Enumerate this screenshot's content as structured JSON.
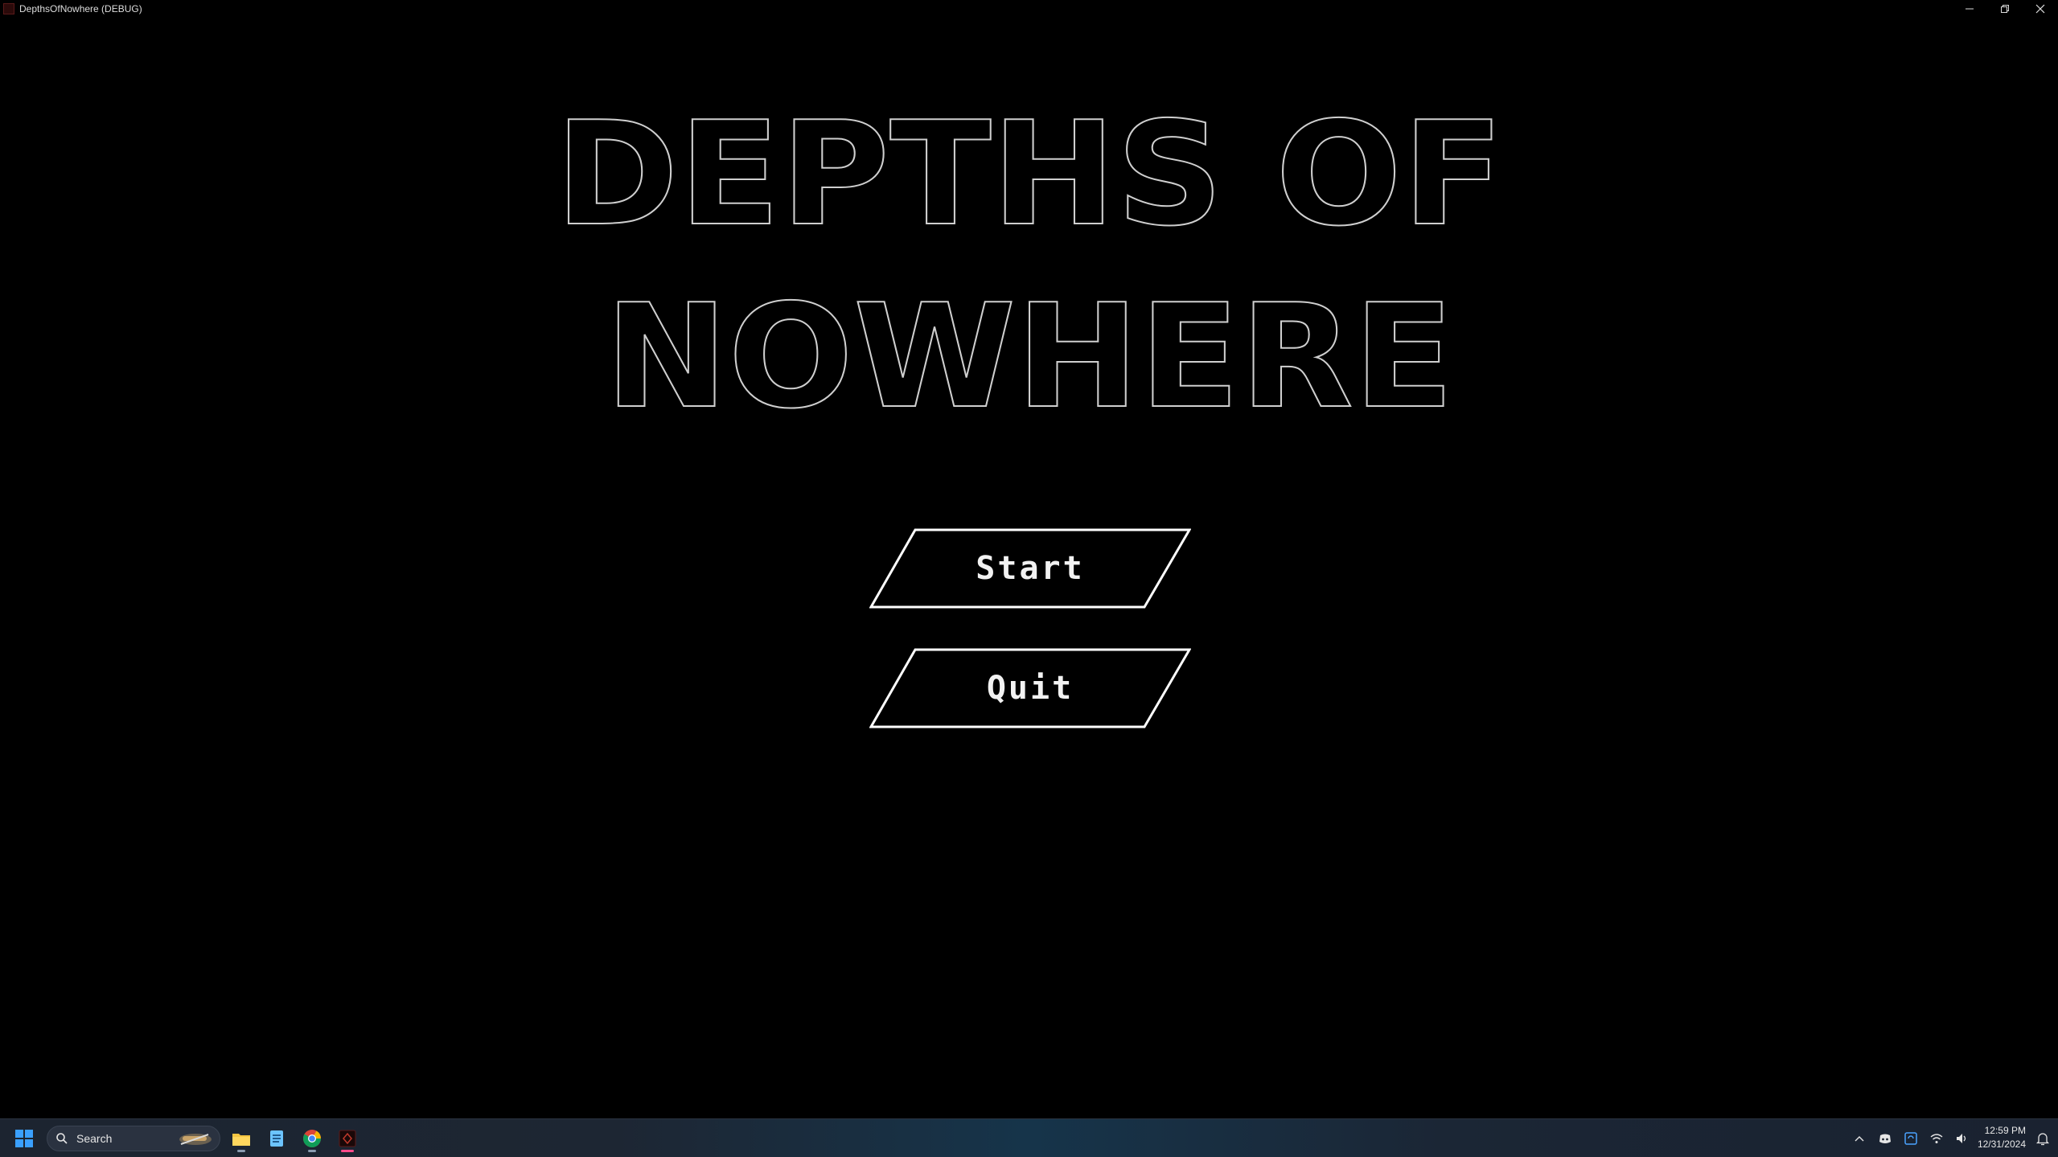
{
  "window": {
    "title": "DepthsOfNowhere (DEBUG)"
  },
  "game": {
    "title_line1": "DEPTHS OF",
    "title_line2": "NOWHERE"
  },
  "menu": {
    "start_label": "Start",
    "quit_label": "Quit"
  },
  "taskbar": {
    "search_placeholder": "Search",
    "apps": [
      "file-explorer",
      "notepad",
      "chrome",
      "depths-of-nowhere"
    ],
    "time": "12:59 PM",
    "date": "12/31/2024"
  },
  "colors": {
    "background": "#000000",
    "title_outline": "#cfcfcf",
    "button_outline": "#ffffff",
    "active_indicator": "#ff4a8a"
  }
}
